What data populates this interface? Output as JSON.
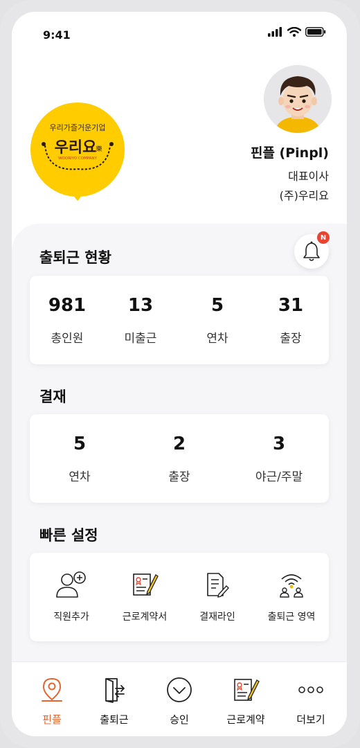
{
  "status_bar": {
    "time": "9:41"
  },
  "brand": {
    "tagline": "우리가즐거운기업",
    "name": "우리요",
    "name_hanja": "樂",
    "english": "WOORIYO COMPANY",
    "color": "#ffcc00"
  },
  "profile": {
    "name": "핀플 (Pinpl)",
    "title": "대표이사",
    "company": "(주)우리요"
  },
  "notification": {
    "badge": "N"
  },
  "attendance": {
    "title": "출퇴근 현황",
    "stats": [
      {
        "value": "981",
        "label": "총인원"
      },
      {
        "value": "13",
        "label": "미출근"
      },
      {
        "value": "5",
        "label": "연차"
      },
      {
        "value": "31",
        "label": "출장"
      }
    ]
  },
  "approval": {
    "title": "결재",
    "stats": [
      {
        "value": "5",
        "label": "연차"
      },
      {
        "value": "2",
        "label": "출장"
      },
      {
        "value": "3",
        "label": "야근/주말"
      }
    ]
  },
  "quick_settings": {
    "title": "빠른 설정",
    "items": [
      {
        "label": "직원추가",
        "icon": "add-person-icon"
      },
      {
        "label": "근로계약서",
        "icon": "contract-icon"
      },
      {
        "label": "결재라인",
        "icon": "approval-line-icon"
      },
      {
        "label": "출퇴근 영역",
        "icon": "area-signal-icon"
      }
    ]
  },
  "bottom_nav": {
    "active_color": "#e8642f",
    "items": [
      {
        "label": "핀플",
        "icon": "map-pin-icon"
      },
      {
        "label": "출퇴근",
        "icon": "door-icon"
      },
      {
        "label": "승인",
        "icon": "check-circle-icon"
      },
      {
        "label": "근로계약",
        "icon": "contract-icon"
      },
      {
        "label": "더보기",
        "icon": "more-icon"
      }
    ]
  }
}
